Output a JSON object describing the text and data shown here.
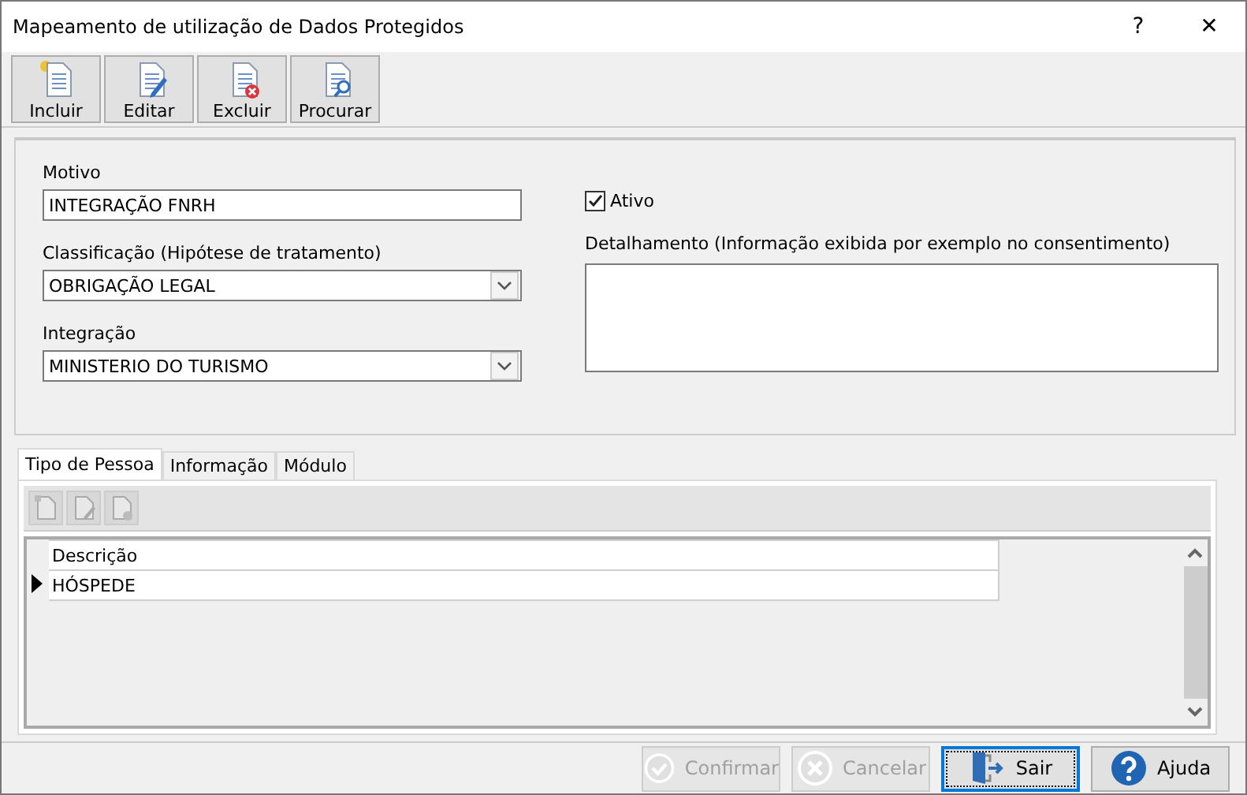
{
  "window": {
    "title": "Mapeamento de utilização de Dados Protegidos",
    "help": "?",
    "close": "✕"
  },
  "toolbar": [
    {
      "label": "Incluir",
      "kind": "new"
    },
    {
      "label": "Editar",
      "kind": "edit"
    },
    {
      "label": "Excluir",
      "kind": "delete"
    },
    {
      "label": "Procurar",
      "kind": "search"
    }
  ],
  "form": {
    "motivo": {
      "label": "Motivo",
      "value": "INTEGRAÇÃO FNRH"
    },
    "ativo": {
      "label": "Ativo",
      "checked": true
    },
    "classificacao": {
      "label": "Classificação (Hipótese de tratamento)",
      "value": "OBRIGAÇÃO LEGAL"
    },
    "detalhamento": {
      "label": "Detalhamento (Informação exibida por exemplo no consentimento)"
    },
    "integracao": {
      "label": "Integração",
      "value": "MINISTERIO DO TURISMO"
    }
  },
  "tabs": [
    {
      "label": "Tipo de Pessoa",
      "selected": true
    },
    {
      "label": "Informação",
      "selected": false
    },
    {
      "label": "Módulo",
      "selected": false
    }
  ],
  "subtoolbar": [
    {
      "kind": "new",
      "disabled": true
    },
    {
      "kind": "edit",
      "disabled": true
    },
    {
      "kind": "delete",
      "disabled": true
    }
  ],
  "grid": {
    "columns": [
      "Descrição"
    ],
    "rows": [
      {
        "cells": [
          "HÓSPEDE"
        ],
        "selected": true
      }
    ]
  },
  "footer": [
    {
      "label": "Confirmar",
      "kind": "confirm",
      "disabled": true,
      "focused": false
    },
    {
      "label": "Cancelar",
      "kind": "cancel",
      "disabled": true,
      "focused": false
    },
    {
      "label": "Sair",
      "kind": "exit",
      "disabled": false,
      "focused": true
    },
    {
      "label": "Ajuda",
      "kind": "help",
      "disabled": false,
      "focused": false
    }
  ]
}
